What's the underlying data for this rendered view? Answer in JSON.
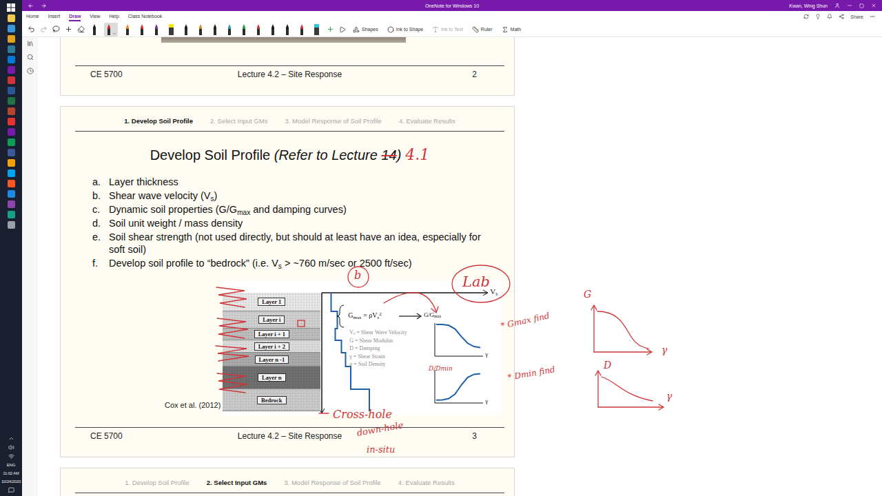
{
  "window": {
    "title": "OneNote for Windows 10",
    "user": "Kwan, Wing Shun"
  },
  "menu": {
    "tabs": [
      {
        "label": "Home",
        "selected": false
      },
      {
        "label": "Insert",
        "selected": false
      },
      {
        "label": "Draw",
        "selected": true
      },
      {
        "label": "View",
        "selected": false
      },
      {
        "label": "Help",
        "selected": false
      },
      {
        "label": "Class Notebook",
        "selected": false
      }
    ],
    "share": "Share"
  },
  "toolbar": {
    "pens": [
      {
        "kind": "pen",
        "color": "#1a1a1a",
        "selected": false
      },
      {
        "kind": "pen",
        "color": "#c0282d",
        "selected": true
      },
      {
        "kind": "pen",
        "color": "#e8841f",
        "selected": false
      },
      {
        "kind": "pen",
        "color": "#d13438",
        "selected": false
      },
      {
        "kind": "pen",
        "color": "#7b2fa0",
        "selected": false
      },
      {
        "kind": "highlighter",
        "color": "#f4e20c",
        "selected": false
      },
      {
        "kind": "pen",
        "color": "#1a1a1a",
        "selected": false
      },
      {
        "kind": "pen",
        "color": "#e8841f",
        "selected": false
      },
      {
        "kind": "pen",
        "color": "#1a1a1a",
        "selected": false
      },
      {
        "kind": "pen",
        "color": "#2b9fb0",
        "selected": false
      },
      {
        "kind": "pen",
        "color": "#1f9e4a",
        "selected": false
      },
      {
        "kind": "pen",
        "color": "#d13438",
        "selected": false
      },
      {
        "kind": "pen",
        "color": "#1a1a1a",
        "selected": false
      },
      {
        "kind": "pen",
        "color": "#1a1a1a",
        "selected": false
      },
      {
        "kind": "pen",
        "color": "#d13438",
        "selected": false
      },
      {
        "kind": "highlighter",
        "color": "#2ec4d6",
        "selected": false
      }
    ],
    "tools": [
      {
        "label": "Shapes",
        "disabled": false
      },
      {
        "label": "Ink to Shape",
        "disabled": false
      },
      {
        "label": "Ink to Text",
        "disabled": true
      },
      {
        "label": "Ruler",
        "disabled": false
      },
      {
        "label": "Math",
        "disabled": false
      }
    ]
  },
  "taskbar": {
    "apps": [
      "#f2c94c",
      "#3a96dd",
      "#e3a21a",
      "#2d7d9a",
      "#0078d4",
      "#7719aa",
      "#d13438",
      "#2b579a",
      "#217346",
      "#b7472a",
      "#e3342f",
      "#7719aa",
      "#0f9d58",
      "#3b5998",
      "#f0a30a",
      "#00a4ef",
      "#ff5722",
      "#1e88e5",
      "#8e44ad",
      "#16a085",
      "#9aa0a6"
    ],
    "language": "ENG",
    "time": "11:02 AM",
    "date": "10/24/2020"
  },
  "previous_slide": {
    "footer": {
      "course": "CE 5700",
      "lecture": "Lecture 4.2 – Site Response",
      "page": "2"
    }
  },
  "slide": {
    "steps": [
      {
        "label": "1. Develop Soil Profile",
        "selected": true
      },
      {
        "label": "2. Select Input GMs",
        "selected": false
      },
      {
        "label": "3. Model Response of Soil Profile",
        "selected": false
      },
      {
        "label": "4. Evaluate Results",
        "selected": false
      }
    ],
    "title": "Develop Soil Profile",
    "reference": [
      {
        "t": "(Refer to Lecture ",
        "struck": false
      },
      {
        "t": "14",
        "struck": true
      },
      {
        "t": ")",
        "struck": false
      }
    ],
    "items": [
      {
        "marker": "a.",
        "text": [
          {
            "t": "Layer thickness"
          }
        ]
      },
      {
        "marker": "b.",
        "text": [
          {
            "t": "Shear wave velocity (V"
          },
          {
            "t": "s",
            "sub": true
          },
          {
            "t": ")"
          }
        ]
      },
      {
        "marker": "c.",
        "text": [
          {
            "t": "Dynamic soil properties (G/G"
          },
          {
            "t": "max",
            "sub": true
          },
          {
            "t": " and damping curves)"
          }
        ]
      },
      {
        "marker": "d.",
        "text": [
          {
            "t": "Soil unit weight / mass density"
          }
        ]
      },
      {
        "marker": "e.",
        "text": [
          {
            "t": "Soil shear strength (not used directly, but should at least have an idea, especially for soft soil)"
          }
        ]
      },
      {
        "marker": "f.",
        "text": [
          {
            "t": "Develop soil profile to “bedrock” (i.e. V"
          },
          {
            "t": "s",
            "sub": true
          },
          {
            "t": " > ~760 m/sec or 2500 ft/sec)"
          }
        ]
      }
    ],
    "figure": {
      "layers": [
        {
          "label": "Layer 1",
          "color": "#e6e6e6"
        },
        {
          "label": "Layer i",
          "color": "#cfcfcf"
        },
        {
          "label": "Layer i + 1",
          "color": "#bdbdbd"
        },
        {
          "label": "Layer i + 2",
          "color": "#dadada"
        },
        {
          "label": "Layer n -1",
          "color": "#a9a9a9"
        },
        {
          "label": "Layer n",
          "color": "#6f6f6f"
        }
      ],
      "bedrock": {
        "label": "Bedrock",
        "color": "#c9c9c9"
      },
      "vs_profile": [
        90,
        150,
        130,
        190,
        230,
        280,
        460
      ],
      "axis": [
        {
          "t": "V"
        },
        {
          "t": "s",
          "sub": true
        }
      ],
      "formula": [
        {
          "t": "G"
        },
        {
          "t": "max",
          "sub": true
        },
        {
          "t": " = ρV"
        },
        {
          "t": "s",
          "sub": true
        },
        {
          "t": "2",
          "sup": true
        }
      ],
      "ratio": [
        {
          "t": "G/G"
        },
        {
          "t": "max",
          "sub": true
        }
      ],
      "legend": [
        [
          {
            "t": "V"
          },
          {
            "t": "s",
            "sub": true
          },
          {
            "t": " = Shear Wave Velocity"
          }
        ],
        [
          {
            "t": "G = Shear Modulus"
          }
        ],
        [
          {
            "t": "D = Damping"
          }
        ],
        [
          {
            "t": "γ = Shear Strain"
          }
        ],
        [
          {
            "t": "ρ = Soil Density"
          }
        ]
      ],
      "strain_labels": [
        "γ",
        "γ"
      ],
      "modulus_curve": [
        1,
        1,
        0.97,
        0.85,
        0.6,
        0.38,
        0.27,
        0.24
      ],
      "damping_curve": [
        0.05,
        0.06,
        0.1,
        0.25,
        0.55,
        0.8,
        0.9,
        0.92
      ]
    },
    "caption": "Cox et al. (2012)",
    "footer": {
      "course": "CE 5700",
      "lecture": "Lecture 4.2 – Site Response",
      "page": "3"
    }
  },
  "next_slide": {
    "steps": [
      {
        "label": "1. Develop Soil Profile",
        "selected": false
      },
      {
        "label": "2. Select Input GMs",
        "selected": true
      },
      {
        "label": "3. Model Response of Soil Profile",
        "selected": false
      },
      {
        "label": "4. Evaluate Results",
        "selected": false
      }
    ]
  },
  "ink": {
    "correction": "4.1",
    "circle": "b",
    "lab": "Lab",
    "notes": [
      "* Gmax find",
      "* Dmin find"
    ],
    "methods": [
      "Cross-hole",
      "down-hole",
      "in-situ"
    ],
    "damping_ratio": "D/Dmin",
    "graphs": [
      {
        "y_label": "G",
        "x_label": "γ"
      },
      {
        "y_label": "D",
        "x_label": "γ"
      }
    ]
  }
}
